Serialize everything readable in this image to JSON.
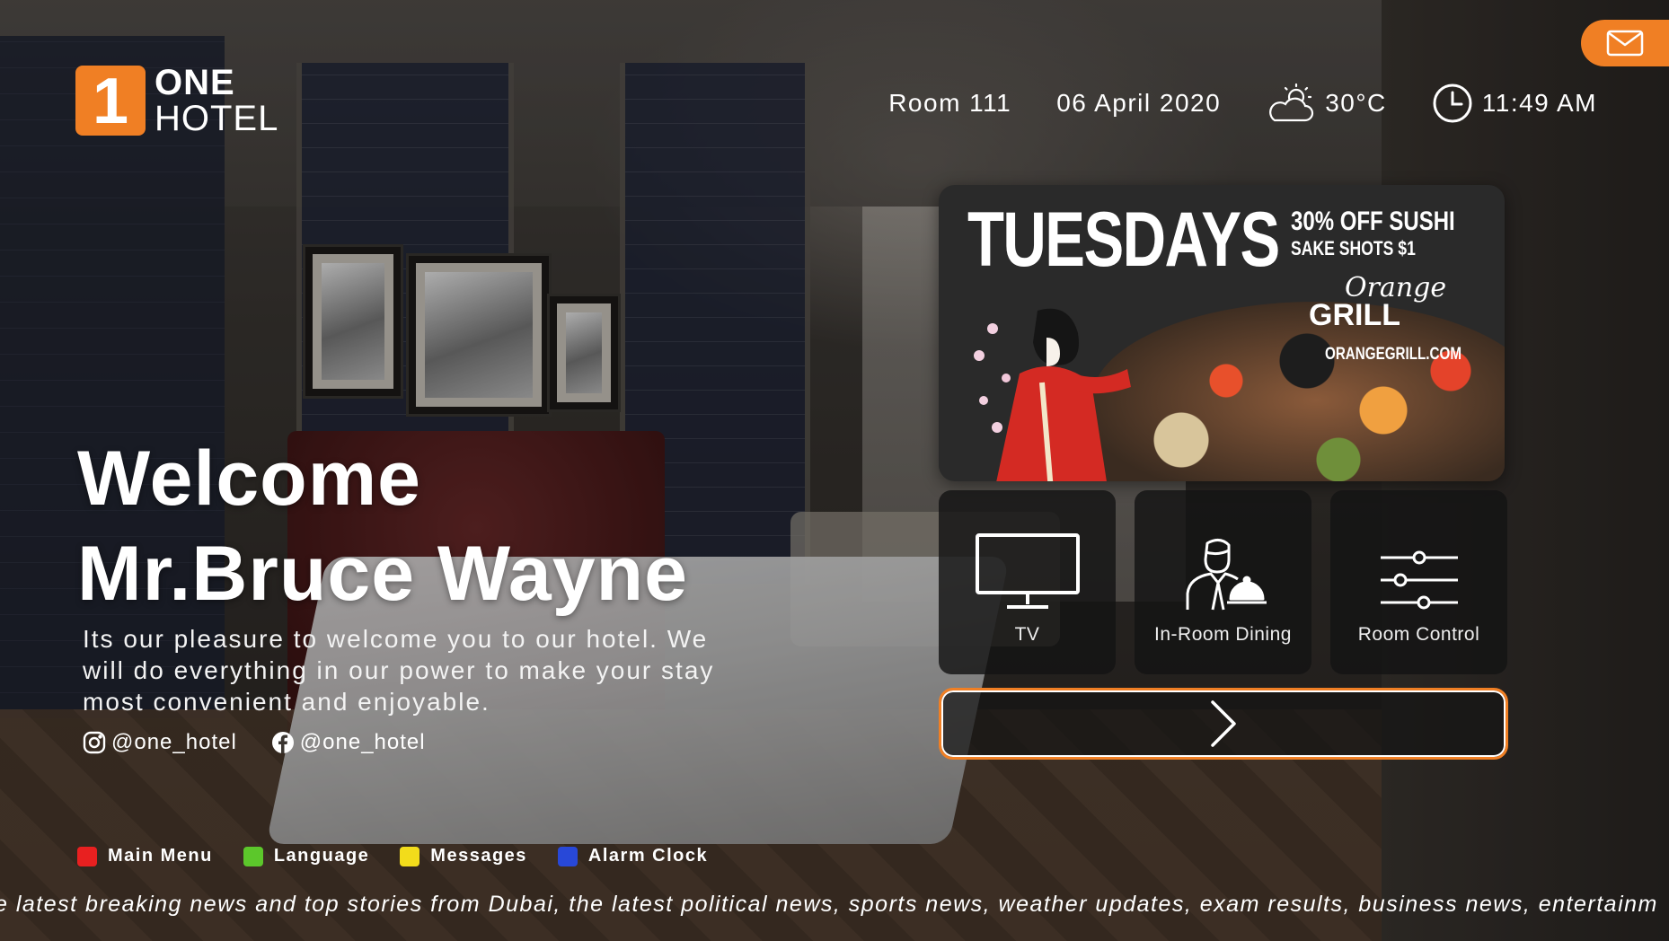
{
  "brand": {
    "mark": "1",
    "line1": "ONE",
    "line2": "HOTEL",
    "color": "#f07f24"
  },
  "status": {
    "room": "Room 111",
    "date": "06 April 2020",
    "weather_icon": "partly-cloudy-icon",
    "temperature": "30°C",
    "clock_icon": "clock-icon",
    "time": "11:49 AM"
  },
  "welcome": {
    "line1": "Welcome",
    "line2": "Mr.Bruce Wayne",
    "intro_1": "Its our pleasure to welcome you to our hotel. We",
    "intro_2": "will do everything in our power to make your stay",
    "intro_3": "most convenient and enjoyable."
  },
  "social": [
    {
      "icon": "instagram-icon",
      "handle": "@one_hotel"
    },
    {
      "icon": "facebook-icon",
      "handle": "@one_hotel"
    }
  ],
  "promo": {
    "title": "TUESDAYS",
    "offer": "30% OFF SUSHI",
    "sub": "SAKE SHOTS $1",
    "brand_1": "Orange",
    "brand_2": "GRILL",
    "url": "ORANGEGRILL.COM"
  },
  "tiles": [
    {
      "icon": "tv-icon",
      "label": "TV"
    },
    {
      "icon": "room-service-icon",
      "label": "In-Room Dining"
    },
    {
      "icon": "sliders-icon",
      "label": "Room Control"
    }
  ],
  "next": {
    "icon": "chevron-right-icon"
  },
  "keys": [
    {
      "label": "Main Menu",
      "color": "#e82020"
    },
    {
      "label": "Language",
      "color": "#5cc72b"
    },
    {
      "label": "Messages",
      "color": "#f2dc1b"
    },
    {
      "label": "Alarm Clock",
      "color": "#2848d8"
    }
  ],
  "ticker": "e latest breaking news and top stories from Dubai, the latest political news, sports news, weather updates, exam results, business news, entertainm",
  "mail": {
    "icon": "mail-icon"
  }
}
